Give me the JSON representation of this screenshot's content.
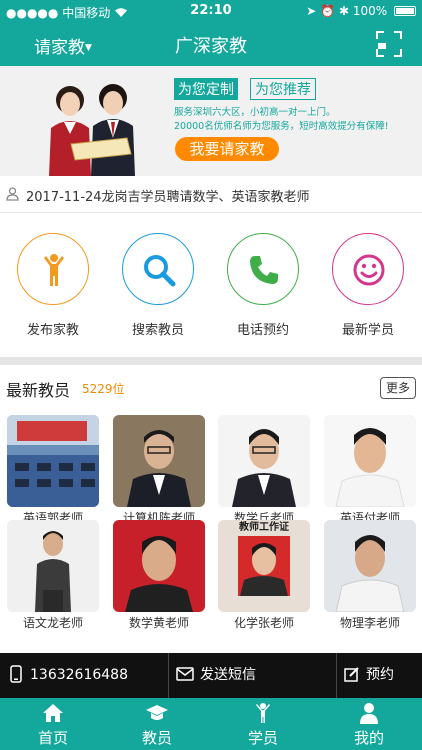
{
  "status_bar": {
    "carrier": "中国移动",
    "time": "22:10",
    "battery": "100%"
  },
  "nav": {
    "city_label": "请家教",
    "title": "广深家教"
  },
  "banner": {
    "tag_left": "为您定制",
    "tag_right": "为您推荐",
    "line1": "服务深圳六大区，小初高一对一上门。",
    "line2": "20000名优师名师为您服务，短时高效提分有保障!",
    "button": "我要请家教"
  },
  "notice": {
    "text": "2017-11-24龙岗吉学员聘请数学、英语家教老师"
  },
  "actions": [
    {
      "label": "发布家教",
      "color": "#f39a1e"
    },
    {
      "label": "搜索教员",
      "color": "#1a9be0"
    },
    {
      "label": "电话预约",
      "color": "#3fae49"
    },
    {
      "label": "最新学员",
      "color": "#d4368e"
    }
  ],
  "teachers_section": {
    "title": "最新教员",
    "count": "5229位",
    "more": "更多"
  },
  "teachers": [
    {
      "name": "英语郭老师"
    },
    {
      "name": "计算机陈老师"
    },
    {
      "name": "数学丘老师"
    },
    {
      "name": "英语付老师"
    },
    {
      "name": "语文龙老师"
    },
    {
      "name": "数学黄老师"
    },
    {
      "name": "化学张老师",
      "badge": "教师工作证"
    },
    {
      "name": "物理李老师"
    }
  ],
  "contact_bar": {
    "phone": "13632616488",
    "sms": "发送短信",
    "book": "预约"
  },
  "tabbar": [
    {
      "label": "首页",
      "icon": "home-icon"
    },
    {
      "label": "教员",
      "icon": "graduation-cap-icon"
    },
    {
      "label": "学员",
      "icon": "student-icon"
    },
    {
      "label": "我的",
      "icon": "person-icon"
    }
  ],
  "colors": {
    "brand": "#14a89d",
    "accent": "#ff8a00"
  }
}
